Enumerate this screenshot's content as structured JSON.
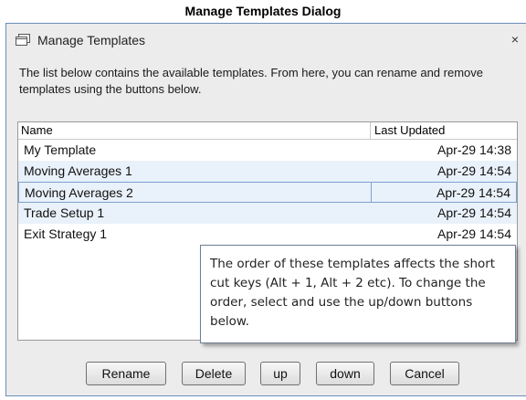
{
  "caption": "Manage Templates Dialog",
  "dialog": {
    "title": "Manage Templates",
    "close_glyph": "×",
    "description": "The list below contains the available templates. From here, you can rename and remove templates using the buttons below."
  },
  "list": {
    "columns": [
      "Name",
      "Last Updated"
    ],
    "rows": [
      {
        "name": "My Template",
        "updated": "Apr-29 14:38"
      },
      {
        "name": "Moving Averages 1",
        "updated": "Apr-29 14:54"
      },
      {
        "name": "Moving Averages 2",
        "updated": "Apr-29 14:54"
      },
      {
        "name": "Trade Setup 1",
        "updated": "Apr-29 14:54"
      },
      {
        "name": "Exit Strategy 1",
        "updated": "Apr-29 14:54"
      }
    ],
    "selected_row": "Moving Averages 2"
  },
  "tooltip": "The order of these templates affects the short cut keys (Alt + 1, Alt + 2 etc).   To change the order, select and use the up/down buttons below.",
  "buttons": {
    "rename": "Rename",
    "delete": "Delete",
    "up": "up",
    "down": "down",
    "cancel": "Cancel"
  },
  "icons": {
    "title": "window-icon",
    "close": "close-icon"
  },
  "colors": {
    "dialog_border": "#6b8db8",
    "row_alt": "#e9f1fa",
    "selection_border": "#7da2ce"
  }
}
